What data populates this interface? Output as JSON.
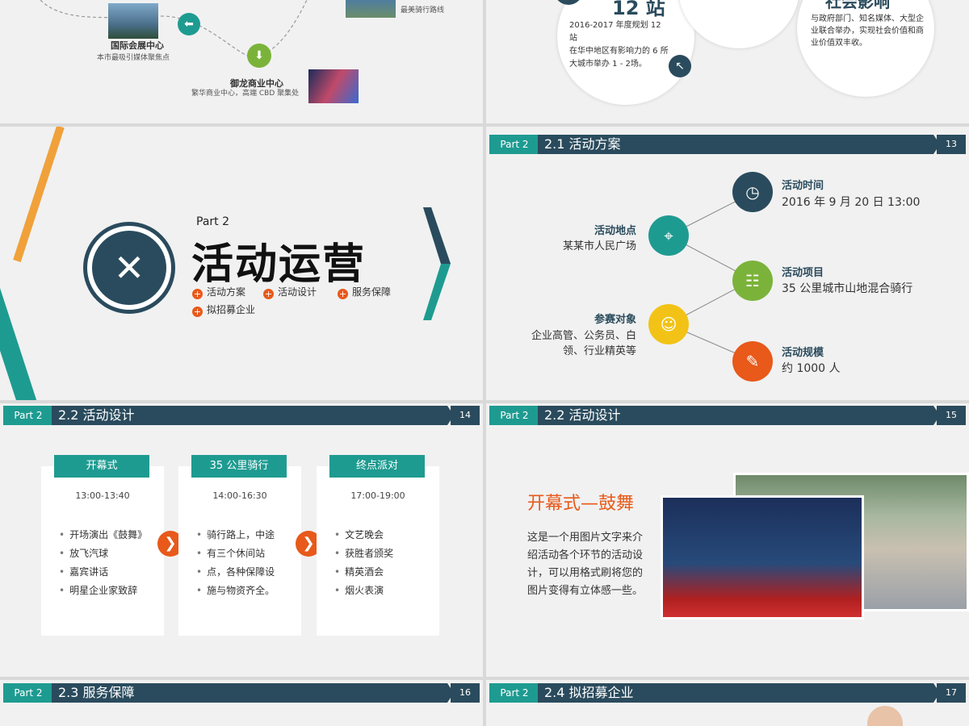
{
  "slide11": {
    "node1": {
      "title": "国际会展中心",
      "desc": "本市最吸引媒体聚焦点"
    },
    "node2": {
      "title": "御龙商业中心",
      "desc": "繁华商业中心，高端 CBD 聚集处"
    },
    "node3": {
      "desc": "最美骑行路线"
    }
  },
  "slide12": {
    "big": "12 站",
    "line1": "2016-2017 年度规划 12 站",
    "line2": "在华中地区有影响力的 6 所大城市举办 1 - 2场。",
    "impact_title": "社会影响",
    "impact_text": "与政府部门、知名媒体、大型企业联合举办，实现社会价值和商业价值双丰收。"
  },
  "cover": {
    "part": "Part 2",
    "title": "活动运营",
    "items": [
      "活动方案",
      "活动设计",
      "服务保障",
      "拟招募企业"
    ]
  },
  "slide13": {
    "tag": "Part 2",
    "title": "2.1  活动方案",
    "num": "13",
    "time_label": "活动时间",
    "time_value": "2016 年 9 月 20 日 13:00",
    "place_label": "活动地点",
    "place_value": "某某市人民广场",
    "project_label": "活动项目",
    "project_value": "35 公里城市山地混合骑行",
    "people_label": "参赛对象",
    "people_value1": "企业高管、公务员、白",
    "people_value2": "领、行业精英等",
    "scale_label": "活动规模",
    "scale_value": "约 1000 人"
  },
  "slide14": {
    "tag": "Part 2",
    "title": "2.2  活动设计",
    "num": "14",
    "cards": [
      {
        "title": "开幕式",
        "time": "13:00-13:40",
        "items": [
          "开场演出《鼓舞》",
          "放飞汽球",
          "嘉宾讲话",
          "明星企业家致辞"
        ]
      },
      {
        "title": "35 公里骑行",
        "time": "14:00-16:30",
        "items": [
          "骑行路上，中途",
          "有三个休间站",
          "点，各种保障设",
          "施与物资齐全。"
        ]
      },
      {
        "title": "终点派对",
        "time": "17:00-19:00",
        "items": [
          "文艺晚会",
          "获胜者颁奖",
          "精英酒会",
          "烟火表演"
        ]
      }
    ]
  },
  "slide15": {
    "tag": "Part 2",
    "title": "2.2  活动设计",
    "num": "15",
    "heading": "开幕式—鼓舞",
    "text": [
      "这是一个用图片文字来介",
      "绍活动各个环节的活动设",
      "计，可以用格式刷将您的",
      "图片变得有立体感一些。"
    ]
  },
  "slide16": {
    "tag": "Part 2",
    "title": "2.3  服务保障",
    "num": "16"
  },
  "slide17": {
    "tag": "Part 2",
    "title": "2.4   拟招募企业",
    "num": "17"
  },
  "colors": {
    "teal": "#1e9b91",
    "navy": "#2a4b5d",
    "orange": "#e8591a",
    "green": "#7bb33a",
    "yellow": "#f2c316",
    "gold": "#f0a13a"
  }
}
